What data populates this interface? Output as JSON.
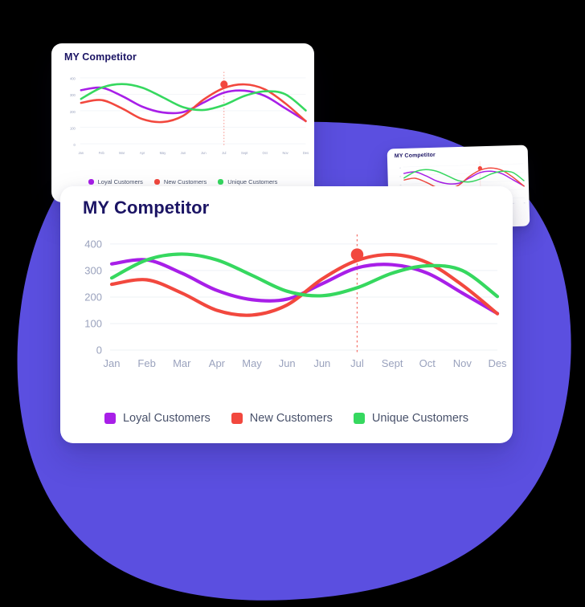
{
  "background": {
    "canvas_color": "#000000",
    "blob_color": "#5B4FE0"
  },
  "cards": [
    {
      "id": "topleft",
      "title": "MY Competitor"
    },
    {
      "id": "right",
      "title": "MY Competitor"
    },
    {
      "id": "main",
      "title": "MY Competitor"
    }
  ],
  "legend": {
    "items": [
      {
        "label": "Loyal Customers",
        "color": "#A81FE8"
      },
      {
        "label": "New Customers",
        "color": "#F2483E"
      },
      {
        "label": "Unique Customers",
        "color": "#36D85F"
      }
    ]
  },
  "chart_data": {
    "type": "line",
    "title": "MY Competitor",
    "xlabel": "",
    "ylabel": "",
    "categories": [
      "Jan",
      "Feb",
      "Mar",
      "Apr",
      "May",
      "Jun",
      "Jun",
      "Jul",
      "Sept",
      "Oct",
      "Nov",
      "Des"
    ],
    "yticks": [
      0,
      100,
      200,
      300,
      400
    ],
    "ylim": [
      0,
      430
    ],
    "grid": true,
    "legend_position": "bottom-center",
    "annotation": {
      "type": "vertical-dashed-marker",
      "at_category": "Jul",
      "series": "New Customers",
      "value": 360,
      "color": "#F2483E"
    },
    "series": [
      {
        "name": "Loyal Customers",
        "color": "#A81FE8",
        "values": [
          325,
          340,
          290,
          225,
          190,
          192,
          250,
          310,
          322,
          290,
          215,
          138
        ]
      },
      {
        "name": "New Customers",
        "color": "#F2483E",
        "values": [
          248,
          265,
          215,
          150,
          132,
          170,
          268,
          338,
          360,
          330,
          245,
          137
        ]
      },
      {
        "name": "Unique Customers",
        "color": "#36D85F",
        "values": [
          272,
          340,
          362,
          340,
          282,
          222,
          205,
          235,
          290,
          318,
          300,
          202
        ]
      }
    ]
  }
}
